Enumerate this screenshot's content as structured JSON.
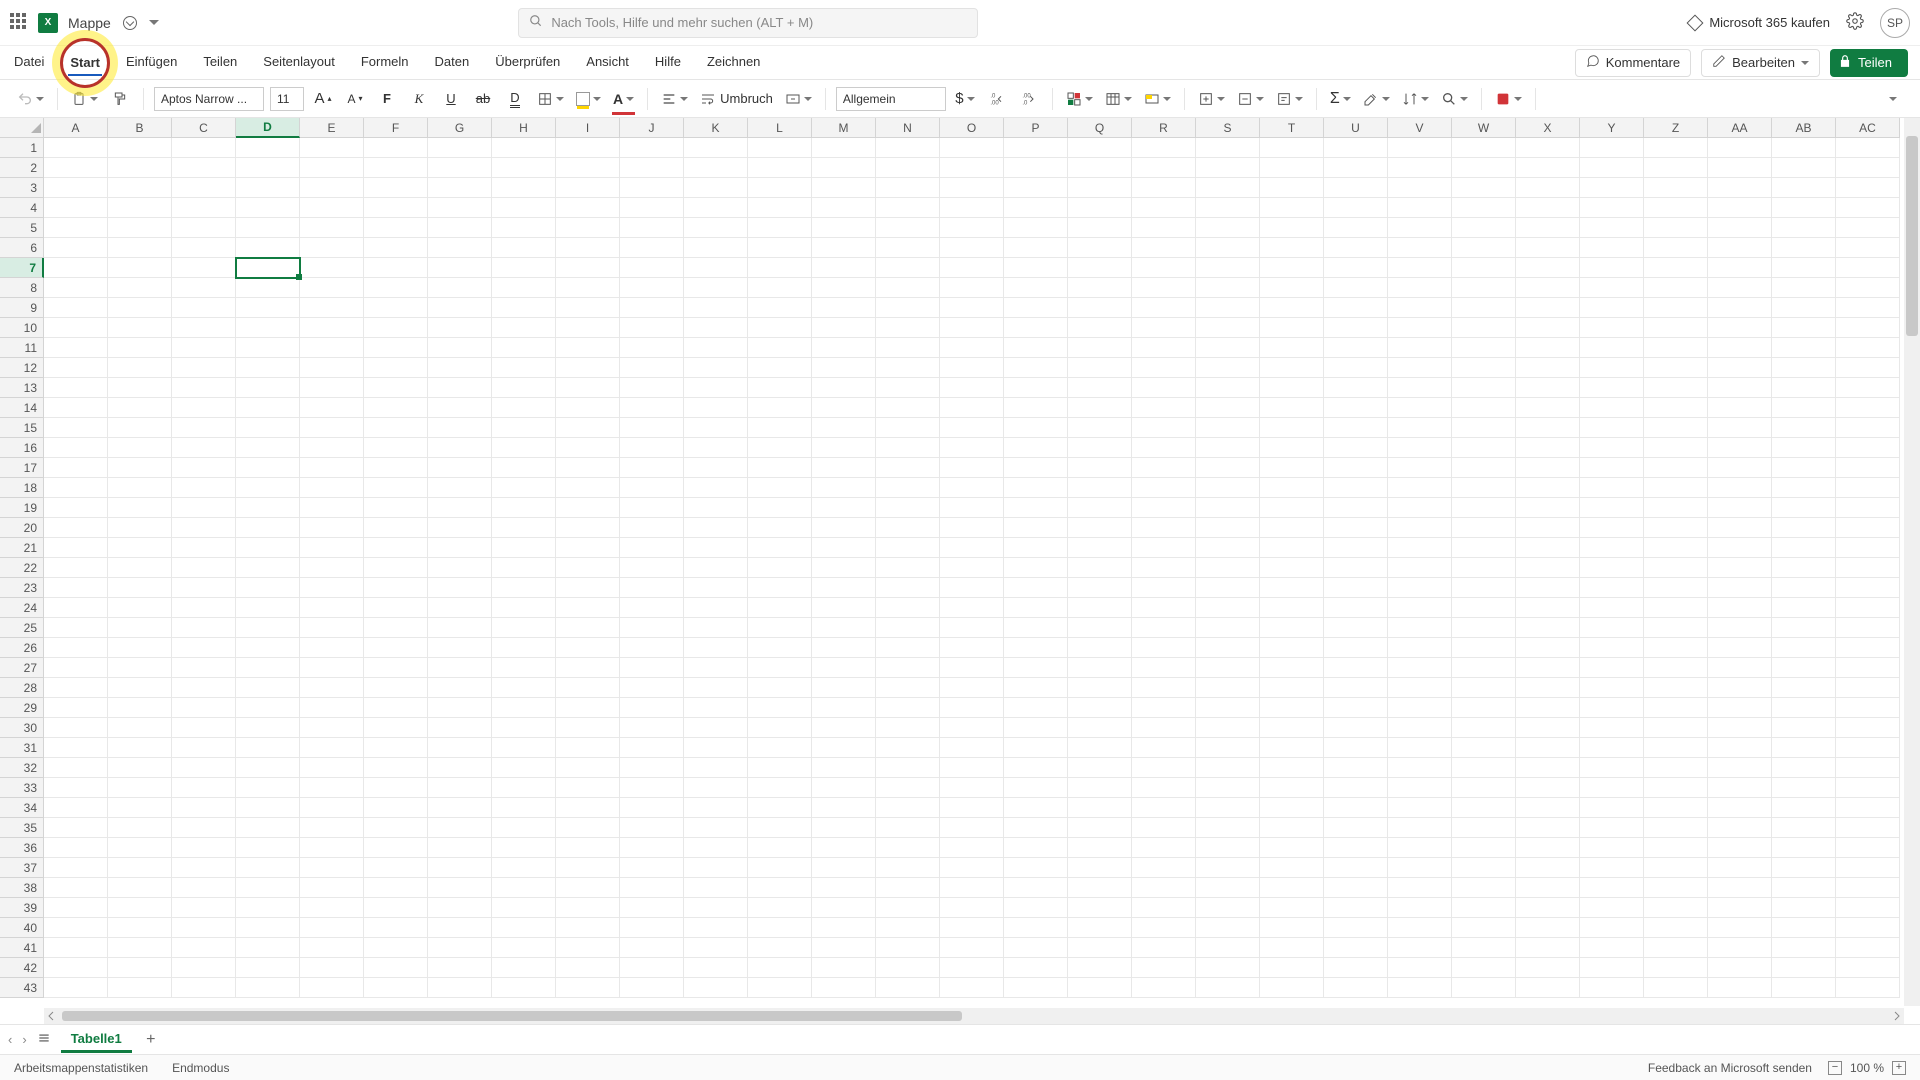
{
  "title": {
    "doc": "Mappe"
  },
  "search": {
    "placeholder": "Nach Tools, Hilfe und mehr suchen (ALT + M)"
  },
  "header_right": {
    "buy": "Microsoft 365 kaufen",
    "avatar": "SP"
  },
  "tabs": [
    "Datei",
    "Start",
    "Einfügen",
    "Teilen",
    "Seitenlayout",
    "Formeln",
    "Daten",
    "Überprüfen",
    "Ansicht",
    "Hilfe",
    "Zeichnen"
  ],
  "active_tab_index": 1,
  "tab_actions": {
    "comments": "Kommentare",
    "edit": "Bearbeiten",
    "share": "Teilen"
  },
  "ribbon": {
    "font_name": "Aptos Narrow ...",
    "font_size": "11",
    "wrap": "Umbruch",
    "number_format": "Allgemein"
  },
  "grid": {
    "columns": [
      "A",
      "B",
      "C",
      "D",
      "E",
      "F",
      "G",
      "H",
      "I",
      "J",
      "K",
      "L",
      "M",
      "N",
      "O",
      "P",
      "Q",
      "R",
      "S",
      "T",
      "U",
      "V",
      "W",
      "X",
      "Y",
      "Z",
      "AA",
      "AB",
      "AC"
    ],
    "rows": 43,
    "selected_col_index": 3,
    "selected_row_index": 6
  },
  "sheet": {
    "active": "Tabelle1"
  },
  "status": {
    "stats": "Arbeitsmappenstatistiken",
    "mode": "Endmodus",
    "feedback": "Feedback an Microsoft senden",
    "zoom": "100 %"
  }
}
